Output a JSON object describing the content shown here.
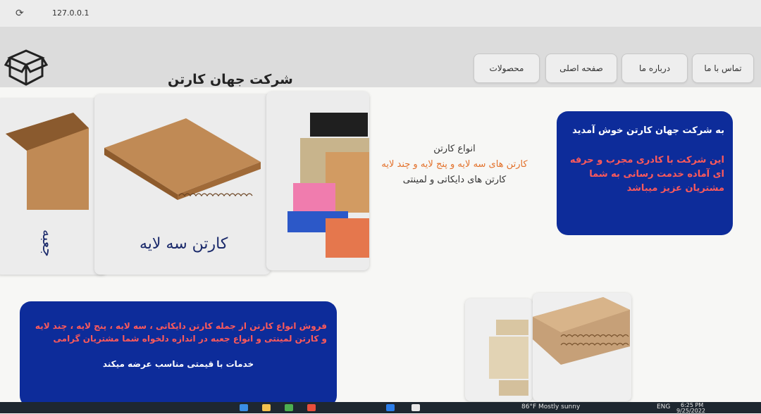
{
  "browser": {
    "url": "127.0.0.1"
  },
  "header": {
    "title": "شرکت جهان کارتن",
    "logo_icon": "box-icon",
    "nav": [
      {
        "label": "تماس با ما"
      },
      {
        "label": "درباره ما"
      },
      {
        "label": "صفحه اصلی"
      },
      {
        "label": "محصولات"
      }
    ]
  },
  "welcome": {
    "title": "به شرکت جهان کارتن خوش آمدید",
    "body": "این شرکت با کادری مجرب و حرفه ای آماده خدمت رسانی به شما مشتریان عزیز میباشد"
  },
  "types": {
    "heading": "انواع کارتن",
    "line1": "کارتن های سه لایه و پنج لایه و چند لایه",
    "line2": "کارتن های دایکاتی و لمینتی"
  },
  "cards": [
    {
      "label": "کارتن سه لایه"
    },
    {
      "label": "جعبه"
    }
  ],
  "sales": {
    "body": "فروش انواع کارتن از جمله کارتن دایکاتی ، سه لایه ، پنج لایه ، چند لایه و کارتن لمینتی و انواع جعبه در اندازه دلخواه شما مشتریان گرامی",
    "sub": "خدمات با قیمتی مناسب عرضه میکند"
  },
  "taskbar": {
    "weather": "86°F  Mostly sunny",
    "lang": "ENG",
    "time": "6:25 PM",
    "date": "9/25/2022"
  },
  "colors": {
    "navy": "#0d2c9a",
    "red_text": "#ff5a5a",
    "orange_text": "#e3712b",
    "cardboard": "#c08a55"
  }
}
